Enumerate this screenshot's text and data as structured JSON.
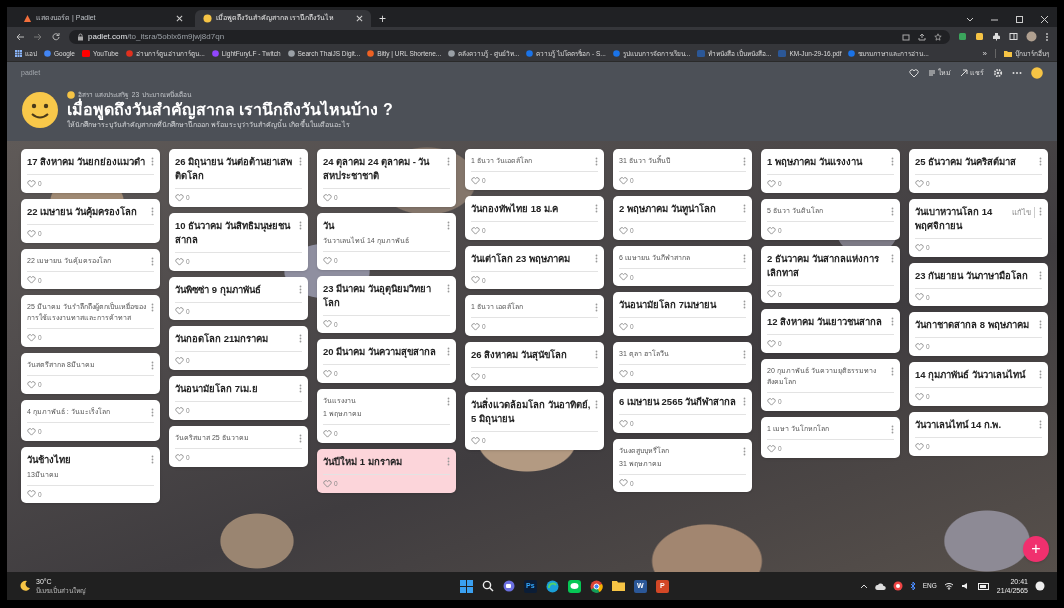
{
  "browser": {
    "tabs": [
      {
        "label": "แสดงบอร์ด | Padlet",
        "selected": false
      },
      {
        "label": "เมื่อพูดถึงวันสำคัญสากล เรานึกถึงวันไห",
        "selected": true
      }
    ],
    "new_tab": "+",
    "url_host": "padlet.com",
    "url_path": "/to_itsra/5oblx6m9jwj8d7qn",
    "bookmarks": [
      {
        "kind": "apps",
        "label": "แอป"
      },
      {
        "kind": "google",
        "label": "Google"
      },
      {
        "kind": "youtube",
        "label": "YouTube"
      },
      {
        "kind": "manga",
        "label": "อ่านการ์ตูน อ่านการ์ตูน..."
      },
      {
        "kind": "twitch",
        "label": "LightFuryLF - Twitch"
      },
      {
        "kind": "globe",
        "label": "Search ThaiJS Digit..."
      },
      {
        "kind": "bitly",
        "label": "Bitly | URL Shortene..."
      },
      {
        "kind": "globe",
        "label": "คลังความรู้ - ศูนย์วิท..."
      },
      {
        "kind": "blue",
        "label": "ความรู้ ไม่โคตรช็อก - S..."
      },
      {
        "kind": "blue",
        "label": "รูปแบบการจัดการเรียน..."
      },
      {
        "kind": "doc",
        "label": "ทำหนังสือ เป็นหนังสือ..."
      },
      {
        "kind": "doc",
        "label": "KM-Jun-29-16.pdf"
      },
      {
        "kind": "blue",
        "label": "ชมรมภาษาและการอ่าน..."
      }
    ],
    "more_bookmarks": "»",
    "other_bookmarks": "บุ๊กมาร์กอื่นๆ"
  },
  "padlet": {
    "brand": "padlet",
    "author": "อิสรา แสงประเสริฐ",
    "likes": "23",
    "time": "ประมาณหนึ่งเดือน",
    "title": "เมื่อพูดถึงวันสำคัญสากล เรานึกถึงวันไหนบ้าง ?",
    "description": "ให้นักศึกษาระบุวันสำคัญสากลที่นักศึกษานึกออก พร้อมระบุว่าวันสำคัญนั้น เกิดขึ้นในเดือนอะไร",
    "actions": [
      {
        "kind": "heart"
      },
      {
        "kind": "new",
        "label": "ใหม่"
      },
      {
        "kind": "share",
        "label": "แชร์"
      },
      {
        "kind": "gear"
      },
      {
        "kind": "more"
      },
      {
        "kind": "avatar"
      }
    ]
  },
  "columns": [
    {
      "cards": [
        {
          "kind": "headline",
          "title": "17 สิงหาคม วันยกย่องแมวดำ",
          "likes": "0",
          "color": "#ffffff"
        },
        {
          "kind": "headline",
          "title": "22 เมษายน วันคุ้มครองโลก",
          "likes": "0",
          "color": "#ffffff"
        },
        {
          "kind": "note",
          "title": "22 เมษายน วันคุ้มครองโลก",
          "likes": "0",
          "color": "#ffffff"
        },
        {
          "kind": "note",
          "title": "25 มีนาคม วันรำลึกถึงผู้ตกเป็นเหยื่อของการใช้แรงงานทาสและการค้าทาส",
          "likes": "0",
          "color": "#ffffff"
        },
        {
          "kind": "note",
          "title": "วันสตรีสากล 8มีนาคม",
          "likes": "0",
          "color": "#ffffff"
        },
        {
          "kind": "note",
          "title": "4 กุมภาพันธ์ : วันมะเร็งโลก",
          "likes": "0",
          "color": "#ffffff"
        },
        {
          "kind": "headline",
          "title": "วันช้างไทย",
          "body": "13มีนาคม",
          "likes": "0",
          "color": "#ffffff"
        }
      ]
    },
    {
      "cards": [
        {
          "kind": "headline",
          "title": "26 มิถุนายน วันต่อต้านยาเสพติดโลก",
          "likes": "0",
          "color": "#ffffff"
        },
        {
          "kind": "headline",
          "title": "10 ธันวาคม วันสิทธิมนุษยชนสากล",
          "likes": "0",
          "color": "#ffffff"
        },
        {
          "kind": "headline",
          "title": "วันพิซซ่า 9 กุมภาพันธ์",
          "likes": "0",
          "color": "#ffffff"
        },
        {
          "kind": "headline",
          "title": "วันกอดโลก 21มกราคม",
          "likes": "0",
          "color": "#ffffff"
        },
        {
          "kind": "headline",
          "title": "วันอนามัยโลก 7เม.ย",
          "likes": "0",
          "color": "#ffffff"
        },
        {
          "kind": "note",
          "title": "วันคริสมาส 25 ธันวาคม",
          "likes": "0",
          "color": "#ffffff"
        }
      ]
    },
    {
      "cards": [
        {
          "kind": "headline",
          "title": "24 ตุลาคม 24 ตุลาคม - วันสหประชาชาติ",
          "likes": "0",
          "color": "#ffffff"
        },
        {
          "kind": "headline",
          "title": "วัน",
          "body": "วันวาเลนไทน์ 14 กุมภาพันธ์",
          "likes": "0",
          "color": "#ffffff"
        },
        {
          "kind": "headline",
          "title": "23 มีนาคม วันอุตุนิยมวิทยาโลก",
          "likes": "0",
          "color": "#ffffff"
        },
        {
          "kind": "headline",
          "title": "20 มีนาคม วันความสุขสากล",
          "likes": "0",
          "color": "#ffffff"
        },
        {
          "kind": "note",
          "title": "วันแรงงาน",
          "body": "1 พฤษภาคม",
          "likes": "0",
          "color": "#ffffff"
        },
        {
          "kind": "headline",
          "title": "วันปีใหม่ 1 มกราคม",
          "likes": "0",
          "color": "#fcd5da"
        }
      ]
    },
    {
      "cards": [
        {
          "kind": "note",
          "title": "1 ธันวา วันเอดส์โลก",
          "likes": "0",
          "color": "#ffffff"
        },
        {
          "kind": "headline",
          "title": "วันกองทัพไทย 18 ม.ค",
          "likes": "0",
          "color": "#ffffff"
        },
        {
          "kind": "headline",
          "title": "วันเต่าโลก 23 พฤษภาคม",
          "likes": "0",
          "color": "#ffffff"
        },
        {
          "kind": "note",
          "title": "1 ธันวา เอดส์โลก",
          "likes": "0",
          "color": "#ffffff"
        },
        {
          "kind": "headline",
          "title": "26 สิงหาคม วันสุนัขโลก",
          "likes": "0",
          "color": "#ffffff"
        },
        {
          "kind": "headline",
          "title": "วันสิ่งแวดล้อมโลก วันอาทิตย์, 5 มิถุนายน",
          "likes": "0",
          "color": "#ffffff"
        }
      ]
    },
    {
      "cards": [
        {
          "kind": "note",
          "title": "31 ธันวา วันสิ้นปี",
          "likes": "0",
          "color": "#ffffff"
        },
        {
          "kind": "headline",
          "title": "2 พฤษภาคม วันทูน่าโลก",
          "likes": "0",
          "color": "#ffffff"
        },
        {
          "kind": "note",
          "title": "6 เมษายน วันกีฬาสากล",
          "likes": "0",
          "color": "#ffffff"
        },
        {
          "kind": "headline",
          "title": "วันอนามัยโลก 7เมษายน",
          "likes": "0",
          "color": "#ffffff"
        },
        {
          "kind": "note",
          "title": "31 ตุลา ฮาโลวีน",
          "likes": "0",
          "color": "#ffffff"
        },
        {
          "kind": "headline",
          "title": "6 เมษายน 2565 วันกีฬาสากล",
          "likes": "0",
          "color": "#ffffff"
        },
        {
          "kind": "note",
          "title": "วันงดสูบบุหรี่โลก",
          "body": "31 พฤษภาคม",
          "likes": "0",
          "color": "#ffffff"
        }
      ]
    },
    {
      "cards": [
        {
          "kind": "headline",
          "title": "1 พฤษภาคม วันแรงงาน",
          "likes": "0",
          "color": "#ffffff"
        },
        {
          "kind": "note",
          "title": "5 ธันวา วันดินโลก",
          "likes": "0",
          "color": "#ffffff"
        },
        {
          "kind": "headline",
          "title": "2 ธันวาคม วันสากลแห่งการเลิกทาส",
          "likes": "0",
          "color": "#ffffff"
        },
        {
          "kind": "headline",
          "title": "12 สิงหาคม วันเยาวชนสากล",
          "likes": "0",
          "color": "#ffffff"
        },
        {
          "kind": "note",
          "title": "20 กุมภาพันธ์ วันความยุติธรรมทางสังคมโลก",
          "likes": "0",
          "color": "#ffffff"
        },
        {
          "kind": "note",
          "title": "1 เมษา วันโกหกโลก",
          "likes": "0",
          "color": "#ffffff"
        }
      ]
    },
    {
      "cards": [
        {
          "kind": "headline",
          "title": "25 ธันวาคม วันคริสต์มาส",
          "likes": "0",
          "color": "#ffffff"
        },
        {
          "kind": "headline",
          "title": "วันเบาหวานโลก 14 พฤศจิกายน",
          "edit_label": "แก้ไข",
          "likes": "0",
          "color": "#ffffff"
        },
        {
          "kind": "headline",
          "title": "23 กันยายน วันภาษามือโลก",
          "likes": "0",
          "color": "#ffffff"
        },
        {
          "kind": "headline",
          "title": "วันกาชาดสากล 8 พฤษภาคม",
          "likes": "0",
          "color": "#ffffff"
        },
        {
          "kind": "headline",
          "title": "14 กุมภาพันธ์ วันวาเลนไทน์",
          "likes": "0",
          "color": "#ffffff"
        },
        {
          "kind": "headline",
          "title": "วันวาเลนไทน์ 14 ก.พ.",
          "likes": "0",
          "color": "#ffffff"
        }
      ]
    }
  ],
  "add_button": "+",
  "taskbar": {
    "temperature": "30°C",
    "weather": "มีเมฆเป็นส่วนใหญ่",
    "apps": [
      {
        "kind": "start"
      },
      {
        "kind": "search"
      },
      {
        "kind": "chat"
      },
      {
        "kind": "photoshop",
        "label": "Ps"
      },
      {
        "kind": "edge"
      },
      {
        "kind": "line"
      },
      {
        "kind": "chrome"
      },
      {
        "kind": "folder"
      },
      {
        "kind": "word",
        "label": "W"
      },
      {
        "kind": "powerpoint",
        "label": "P"
      }
    ],
    "language": "ENG",
    "time": "20:41",
    "date": "21/4/2565"
  }
}
